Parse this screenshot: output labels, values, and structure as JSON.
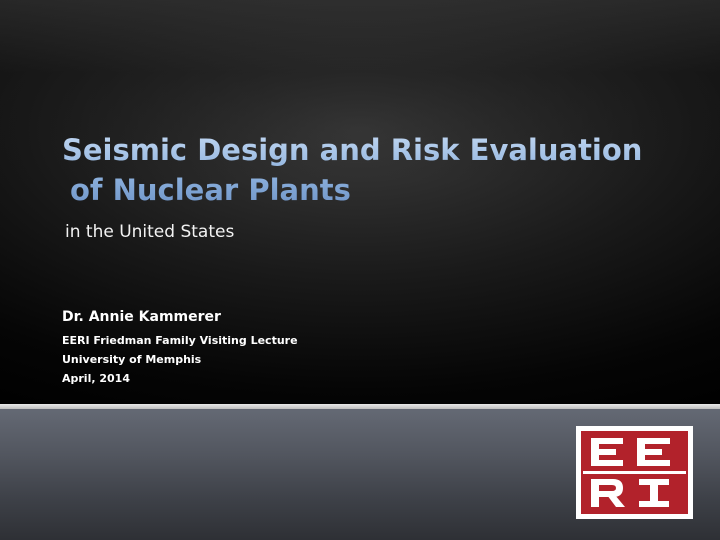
{
  "slide": {
    "title_line1": "Seismic Design and Risk Evaluation",
    "title_line2": "of Nuclear Plants",
    "subtitle": "in the United States",
    "author": {
      "name": "Dr. Annie Kammerer",
      "event": "EERI Friedman Family Visiting Lecture",
      "institution": "University of Memphis",
      "date": "April, 2014"
    },
    "logo": {
      "name": "eeri-logo",
      "text": "EERI",
      "color": "#b2222b"
    }
  }
}
